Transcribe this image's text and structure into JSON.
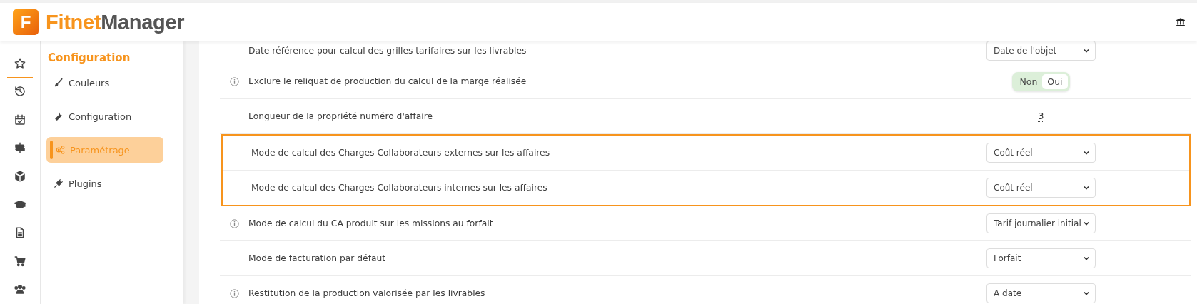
{
  "header": {
    "logo_letter": "F",
    "brand_first": "Fitnet",
    "brand_second": "Manager"
  },
  "rail": [
    {
      "selected": true
    },
    {
      "selected": false
    },
    {
      "selected": false
    },
    {
      "selected": false
    },
    {
      "selected": false
    },
    {
      "selected": false
    },
    {
      "selected": false
    },
    {
      "selected": false
    },
    {
      "selected": false
    }
  ],
  "submenu": {
    "title": "Configuration",
    "items": [
      {
        "label": "Couleurs",
        "selected": false
      },
      {
        "label": "Configuration",
        "selected": false
      },
      {
        "label": "Paramétrage",
        "selected": true
      },
      {
        "label": "Plugins",
        "selected": false
      }
    ]
  },
  "settings": [
    {
      "label": "Date référence pour calcul des grilles tarifaires sur les livrables",
      "info": false,
      "highlighted": false,
      "kind": "select",
      "value": "Date de l'objet"
    },
    {
      "label": "Exclure le reliquat de production du calcul de la marge réalisée",
      "info": true,
      "highlighted": false,
      "kind": "toggle",
      "options": [
        {
          "label": "Non",
          "selected": false
        },
        {
          "label": "Oui",
          "selected": true
        }
      ]
    },
    {
      "label": "Longueur de la propriété numéro d'affaire",
      "info": false,
      "highlighted": false,
      "kind": "number",
      "value": "3"
    },
    {
      "label": "Mode de calcul des Charges Collaborateurs externes sur les affaires",
      "info": false,
      "highlighted": true,
      "kind": "select",
      "value": "Coût réel"
    },
    {
      "label": "Mode de calcul des Charges Collaborateurs internes sur les affaires",
      "info": false,
      "highlighted": true,
      "kind": "select",
      "value": "Coût réel"
    },
    {
      "label": "Mode de calcul du CA produit sur les missions au forfait",
      "info": true,
      "highlighted": false,
      "kind": "select",
      "value": "Tarif journalier initial"
    },
    {
      "label": "Mode de facturation par défaut",
      "info": false,
      "highlighted": false,
      "kind": "select",
      "value": "Forfait"
    },
    {
      "label": "Restitution de la production valorisée par les livrables",
      "info": true,
      "highlighted": false,
      "kind": "select",
      "value": "A date"
    }
  ]
}
